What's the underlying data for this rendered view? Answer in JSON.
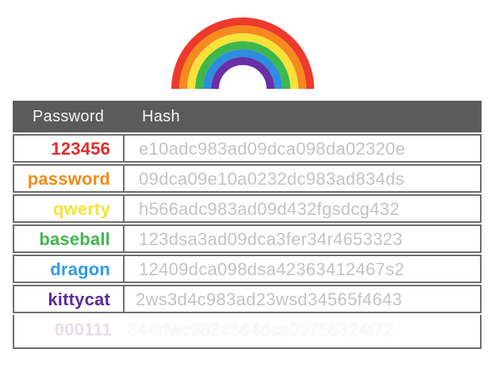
{
  "table": {
    "headers": {
      "password": "Password",
      "hash": "Hash"
    },
    "rows": [
      {
        "password": "123456",
        "hash": "e10adc983ad09dca098da02320e",
        "color": "#e32b2b"
      },
      {
        "password": "password",
        "hash": "09dca09e10a0232dc983ad834ds",
        "color": "#f08b1a"
      },
      {
        "password": "qwerty",
        "hash": "h566adc983ad09d432fgsdcg432",
        "color": "#f2e33a"
      },
      {
        "password": "baseball",
        "hash": "123dsa3ad09dca3fer34r4653323",
        "color": "#3db84a"
      },
      {
        "password": "dragon",
        "hash": "12409dca098dsa42363412467s2",
        "color": "#2d9ee0"
      },
      {
        "password": "kittycat",
        "hash": "2ws3d4c983ad23wsd34565f4643",
        "color": "#5a2d9c"
      },
      {
        "password": "000111",
        "hash": "344rfwc9834564dca09756324t72",
        "color": "#e6dcf0"
      }
    ]
  },
  "rainbow": {
    "bands": [
      "#ee3a2c",
      "#f58a1f",
      "#f7e23a",
      "#3db84a",
      "#2d8ee0",
      "#6a2ea6"
    ]
  }
}
